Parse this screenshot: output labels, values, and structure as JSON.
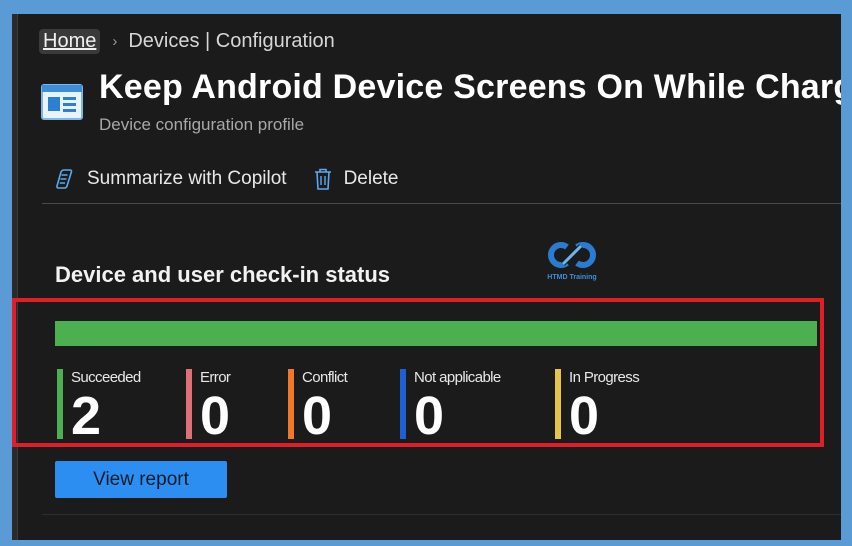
{
  "breadcrumb": {
    "home": "Home",
    "separator": "›",
    "current": "Devices | Configuration"
  },
  "header": {
    "icon": "device-profile-icon",
    "title": "Keep Android Device Screens On While Chargi",
    "subtitle": "Device configuration profile"
  },
  "toolbar": {
    "summarize": {
      "icon": "copilot-icon",
      "label": "Summarize with Copilot"
    },
    "delete": {
      "icon": "trash-icon",
      "label": "Delete"
    }
  },
  "logo": {
    "text": "HTMD Training"
  },
  "checkin": {
    "title": "Device and user check-in status",
    "bar_color": "#4caf50",
    "bar_fraction": 1.0,
    "stats": [
      {
        "label": "Succeeded",
        "value": "2",
        "color": "#4caf50"
      },
      {
        "label": "Error",
        "value": "0",
        "color": "#e07078"
      },
      {
        "label": "Conflict",
        "value": "0",
        "color": "#f0782a"
      },
      {
        "label": "Not applicable",
        "value": "0",
        "color": "#1f5fd1"
      },
      {
        "label": "In Progress",
        "value": "0",
        "color": "#e6c34a"
      }
    ]
  },
  "actions": {
    "view_report": "View report"
  },
  "colors": {
    "highlight": "#e11d2a",
    "accent": "#2b8ef0",
    "background": "#1b1b1b",
    "outer": "#5b9bd5"
  }
}
